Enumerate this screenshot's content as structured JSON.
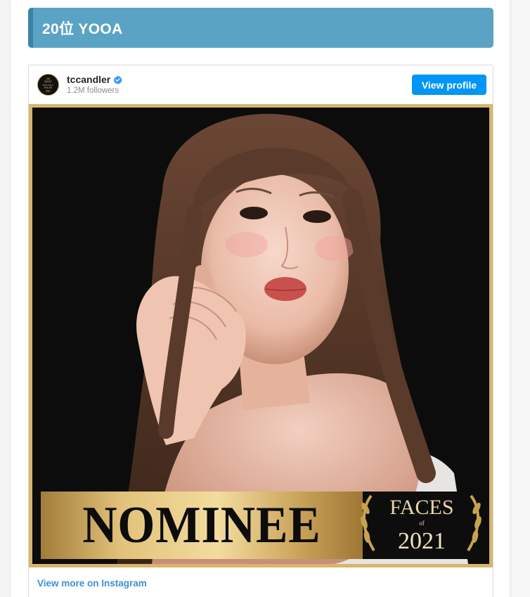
{
  "heading": {
    "title": "20位 YOOA"
  },
  "embed": {
    "username": "tccandler",
    "verified": true,
    "followers": "1.2M followers",
    "view_profile_label": "View profile",
    "view_more_label": "View more on Instagram",
    "avatar_text_lines": [
      "100",
      "MOST",
      "BEAUTIFUL",
      "FACES",
      "2021"
    ]
  },
  "banner": {
    "nominee_text": "NOMINEE",
    "faces_text": "FACES",
    "of_text": "of",
    "year_text": "2021"
  },
  "colors": {
    "heading_bg": "#5ba3c5",
    "heading_accent": "#3b82a8",
    "button_blue": "#0095f6",
    "link_blue": "#3d8fd1",
    "gold_frame": "#d8b56c"
  }
}
